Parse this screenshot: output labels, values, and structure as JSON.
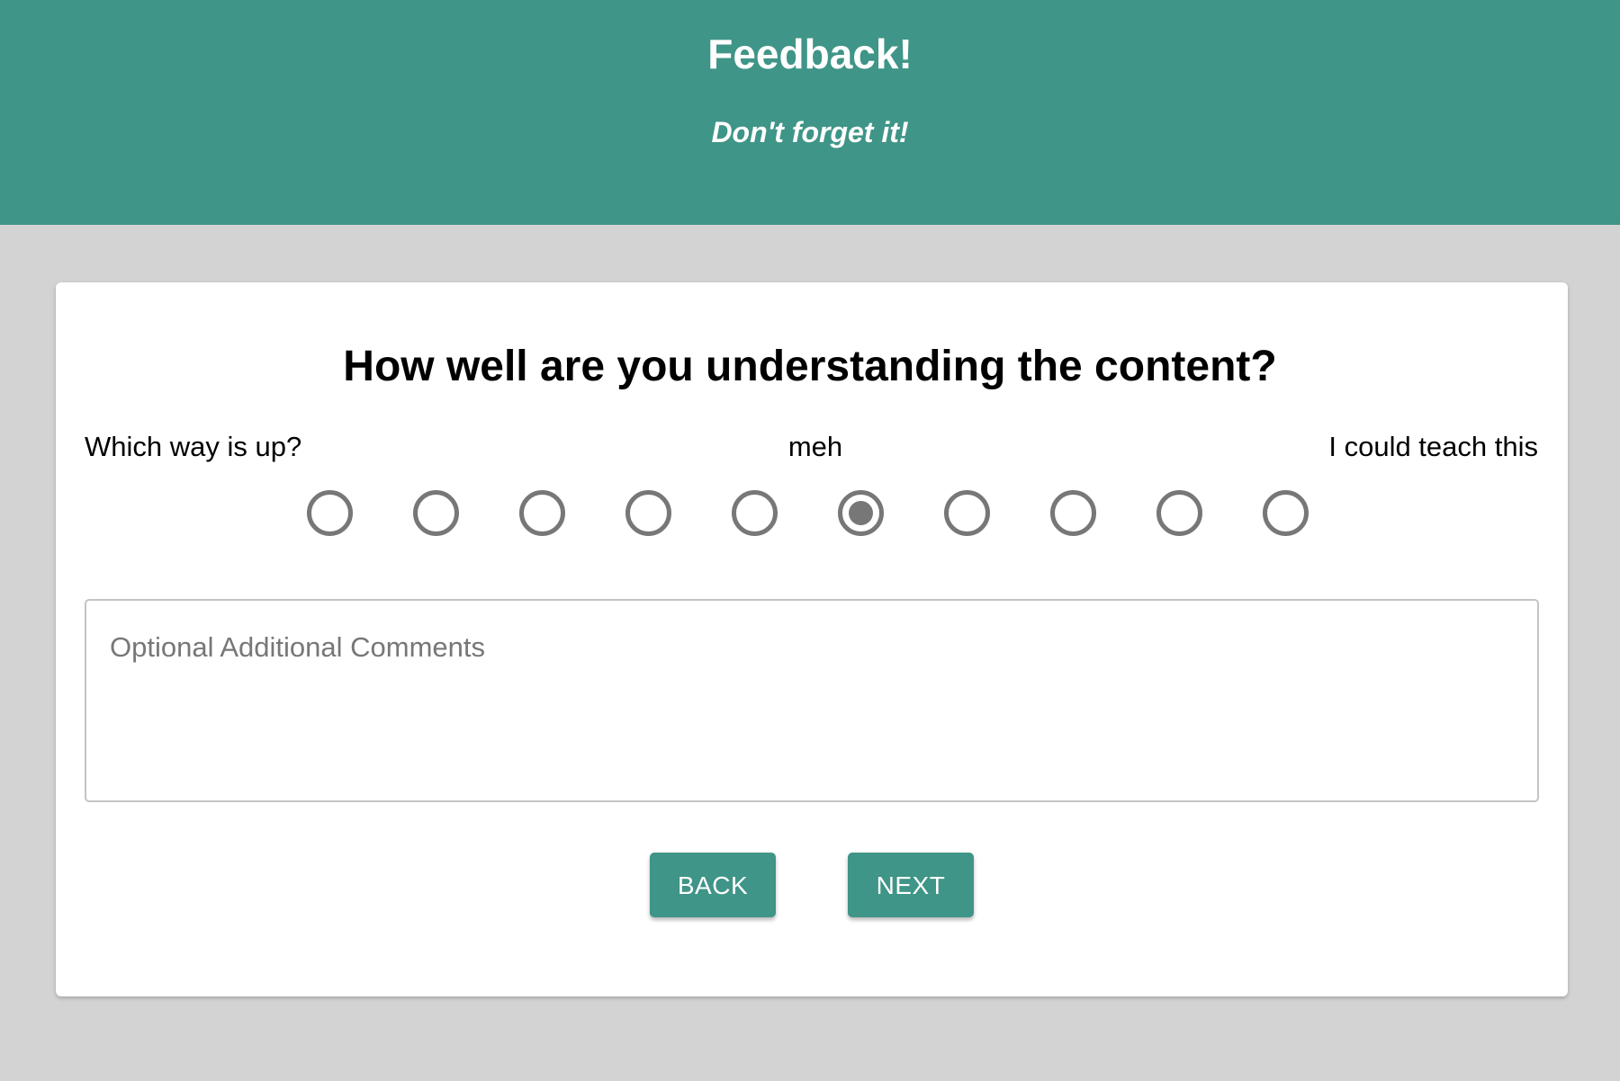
{
  "header": {
    "title": "Feedback!",
    "subtitle": "Don't forget it!"
  },
  "question": {
    "text": "How well are you understanding the content?",
    "scale_low_label": "Which way is up?",
    "scale_mid_label": "meh",
    "scale_high_label": "I could teach this",
    "options_count": 10,
    "selected_option": 6
  },
  "comments": {
    "placeholder": "Optional Additional Comments",
    "value": ""
  },
  "buttons": {
    "back_label": "BACK",
    "next_label": "NEXT"
  },
  "colors": {
    "header_bg": "#3f9587",
    "page_bg": "#d3d3d3",
    "card_bg": "#ffffff",
    "radio": "#777777",
    "button_bg": "#3f9587",
    "button_text": "#ffffff"
  }
}
